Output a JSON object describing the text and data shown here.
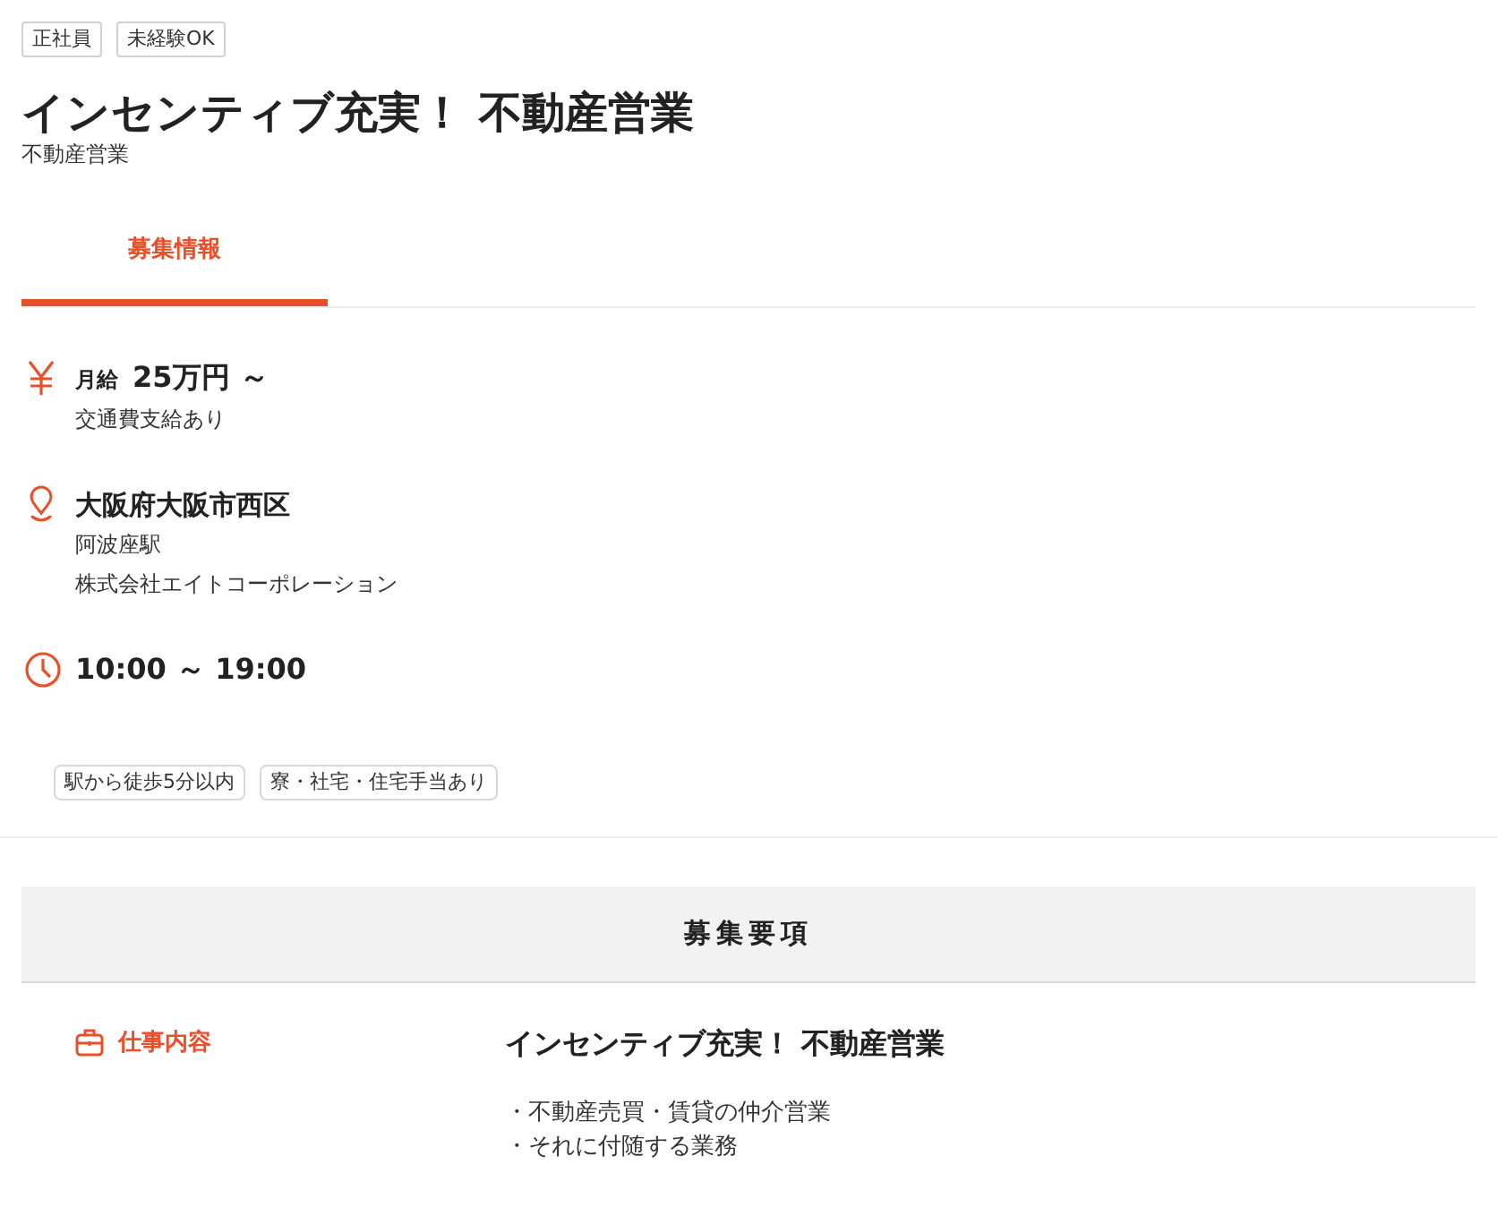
{
  "tags": [
    "正社員",
    "未経験OK"
  ],
  "title": "インセンティブ充実！ 不動産営業",
  "subtitle": "不動産営業",
  "tabs": [
    {
      "label": "募集情報",
      "selected": true
    }
  ],
  "summary": [
    {
      "kind": "salary",
      "label": "月給",
      "value": "25万円 ～",
      "notes": [
        "交通費支給あり"
      ]
    },
    {
      "kind": "location",
      "value": "大阪府大阪市西区",
      "notes": [
        "阿波座駅",
        "株式会社エイトコーポレーション"
      ]
    },
    {
      "kind": "hours",
      "value": "10:00 ～ 19:00"
    }
  ],
  "feature_tags": [
    "駅から徒歩5分以内",
    "寮・社宅・住宅手当あり"
  ],
  "details": {
    "heading": "募集要項",
    "rows": [
      {
        "kind": "job",
        "label": "仕事内容",
        "title": "インセンティブ充実！ 不動産営業",
        "lines": [
          "・不動産売買・賃貸の仲介営業",
          "・それに付随する業務"
        ]
      }
    ]
  }
}
